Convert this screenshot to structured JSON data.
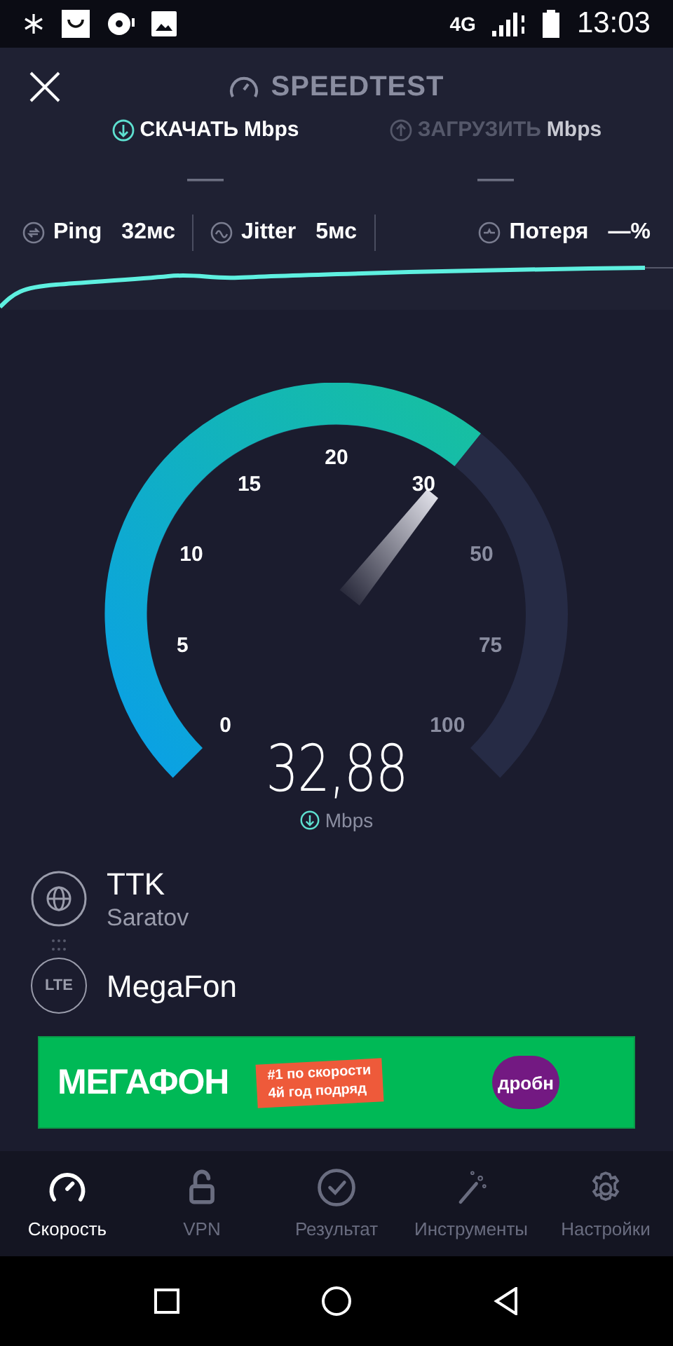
{
  "status_bar": {
    "network": "4G",
    "time": "13:03"
  },
  "header": {
    "title": "SPEEDTEST"
  },
  "modes": [
    {
      "label": "СКАЧАТЬ",
      "unit": "Mbps",
      "value": "—",
      "selected": true,
      "kind": "download"
    },
    {
      "label": "ЗАГРУЗИТЬ",
      "unit": "Mbps",
      "value": "—",
      "selected": false,
      "kind": "upload"
    }
  ],
  "stats": [
    {
      "label": "Ping",
      "value": "32мс",
      "kind": "ping"
    },
    {
      "label": "Jitter",
      "value": "5мс",
      "kind": "jitter"
    },
    {
      "label": "Потеря",
      "value": "—%",
      "kind": "loss"
    }
  ],
  "gauge": {
    "ticks": [
      "0",
      "5",
      "10",
      "15",
      "20",
      "30",
      "50",
      "75",
      "100"
    ],
    "reading": "32,88",
    "unit": "Mbps"
  },
  "server": {
    "name": "TTK",
    "location": "Saratov"
  },
  "provider": {
    "badge": "LTE",
    "name": "MegaFon"
  },
  "ad": {
    "brand": "МЕГАФОН",
    "tagline_1": "#1 по скорости",
    "tagline_2": "4й год подряд",
    "button": "дробн"
  },
  "tabs": [
    {
      "label": "Скорость",
      "selected": true,
      "kind": "speed"
    },
    {
      "label": "VPN",
      "selected": false,
      "kind": "vpn"
    },
    {
      "label": "Результат",
      "selected": false,
      "kind": "results"
    },
    {
      "label": "Инструменты",
      "selected": false,
      "kind": "tools"
    },
    {
      "label": "Настройки",
      "selected": false,
      "kind": "settings"
    }
  ]
}
